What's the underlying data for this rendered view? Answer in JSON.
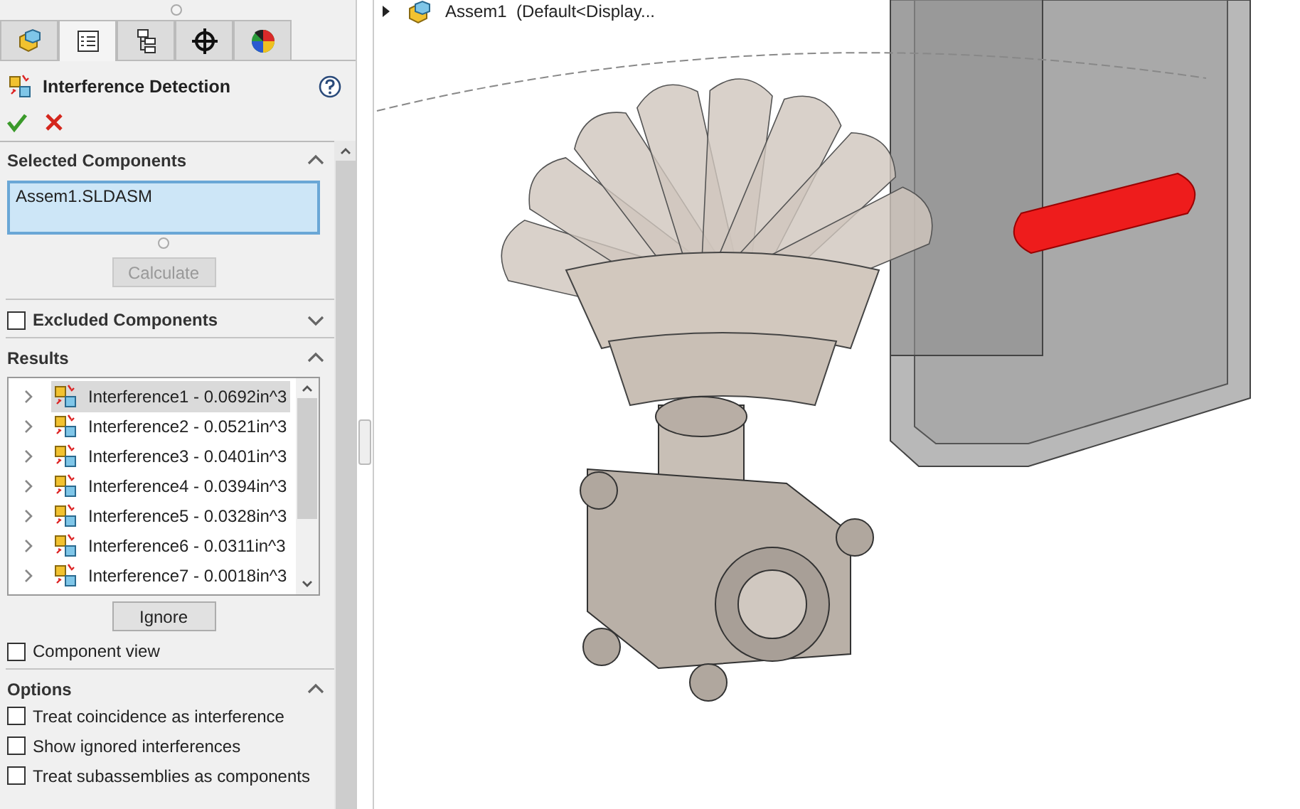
{
  "panel_tabs": [
    {
      "kind": "feature_manager",
      "selected": false
    },
    {
      "kind": "property_manager",
      "selected": true
    },
    {
      "kind": "configuration_manager",
      "selected": false
    },
    {
      "kind": "dimxpert",
      "selected": false
    },
    {
      "kind": "display_manager",
      "selected": false
    }
  ],
  "title": "Interference Detection",
  "selected_components": {
    "title": "Selected Components",
    "expanded": true,
    "items": [
      "Assem1.SLDASM"
    ],
    "button": "Calculate",
    "button_disabled": true
  },
  "excluded_components": {
    "title": "Excluded Components",
    "checked": false,
    "expanded": false
  },
  "results": {
    "title": "Results",
    "expanded": true,
    "items": [
      {
        "label": "Interference1 - 0.0692in^3",
        "selected": true,
        "expanded": false
      },
      {
        "label": "Interference2 - 0.0521in^3",
        "selected": false,
        "expanded": false
      },
      {
        "label": "Interference3 - 0.0401in^3",
        "selected": false,
        "expanded": false
      },
      {
        "label": "Interference4 - 0.0394in^3",
        "selected": false,
        "expanded": false
      },
      {
        "label": "Interference5 - 0.0328in^3",
        "selected": false,
        "expanded": false
      },
      {
        "label": "Interference6 - 0.0311in^3",
        "selected": false,
        "expanded": false
      },
      {
        "label": "Interference7 - 0.0018in^3",
        "selected": false,
        "expanded": false
      }
    ],
    "button": "Ignore"
  },
  "component_view": {
    "label": "Component view",
    "checked": false
  },
  "options": {
    "title": "Options",
    "expanded": true,
    "items": [
      {
        "label": "Treat coincidence as interference",
        "checked": false
      },
      {
        "label": "Show ignored interferences",
        "checked": false
      },
      {
        "label": "Treat subassemblies as components",
        "checked": false
      }
    ]
  },
  "tree": {
    "label": "Assem1  (Default<Display...",
    "expanded": false
  }
}
